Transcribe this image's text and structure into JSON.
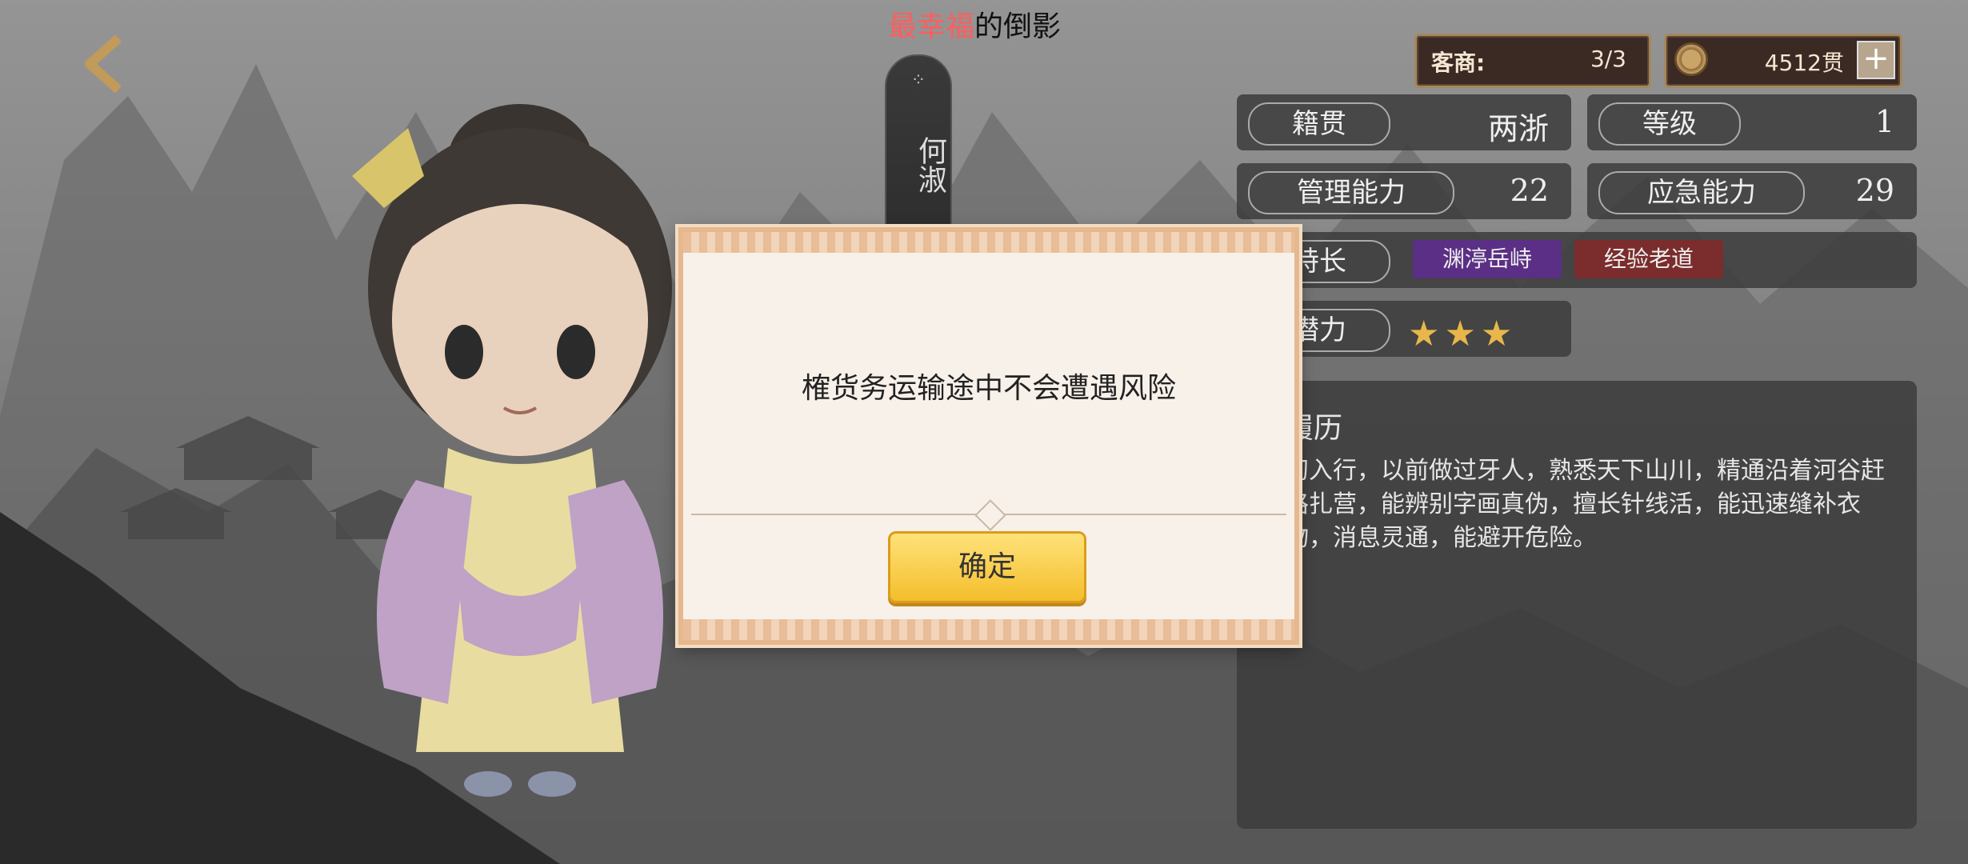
{
  "top_title": {
    "highlight": "最幸福",
    "rest": "的倒影"
  },
  "character": {
    "name_vertical": "何淑"
  },
  "resources": {
    "merchant_label": "客商:",
    "merchant_value": "3/3",
    "coins_value": "4512贯",
    "plus_label": "+"
  },
  "stats": {
    "origin_label": "籍贯",
    "origin_value": "两浙",
    "level_label": "等级",
    "level_value": "1",
    "management_label": "管理能力",
    "management_value": "22",
    "emergency_label": "应急能力",
    "emergency_value": "29",
    "specialty_label": "特长",
    "tags": [
      "渊渟岳峙",
      "经验老道"
    ],
    "potential_label": "潜力",
    "potential_stars": 3
  },
  "bio": {
    "heading": "履历",
    "text": "初入行，以前做过牙人，熟悉天下山川，精通沿着河谷赶路扎营，能辨别字画真伪，擅长针线活，能迅速缝补衣物，消息灵通，能避开危险。"
  },
  "modal": {
    "message": "榷货务运输途中不会遭遇风险",
    "ok_label": "确定"
  },
  "colors": {
    "title_highlight": "#ff5e5e",
    "button_gold": "#f4be2b",
    "tag_purple": "#5b2f86",
    "tag_red": "#7b2c2c"
  }
}
